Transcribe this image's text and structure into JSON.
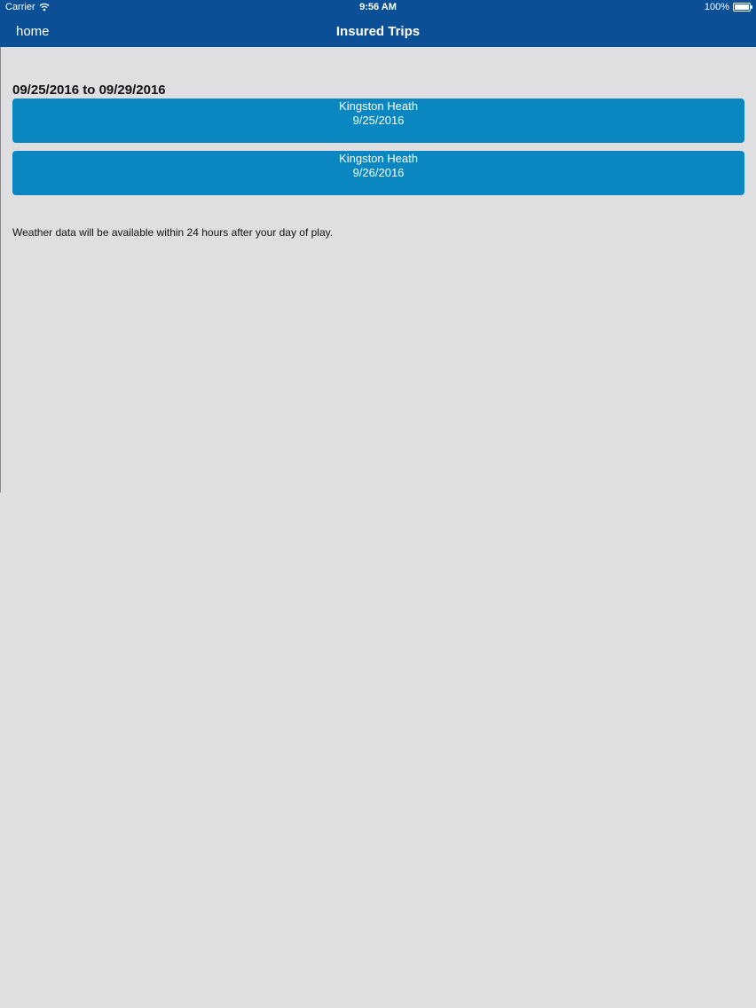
{
  "status_bar": {
    "carrier": "Carrier",
    "time": "9:56 AM",
    "battery": "100%",
    "wifi_icon": "wifi-icon",
    "battery_icon": "battery-icon"
  },
  "nav": {
    "back_label": "home",
    "title": "Insured Trips"
  },
  "colors": {
    "nav_background": "#0b4f96",
    "button_background": "#0a87c1",
    "page_background": "#dfdfe1"
  },
  "trips": {
    "date_range": "09/25/2016 to 09/29/2016",
    "items": [
      {
        "course": "Kingston Heath",
        "date": "9/25/2016"
      },
      {
        "course": "Kingston Heath",
        "date": "9/26/2016"
      }
    ]
  },
  "weather_note": "Weather data will be available within 24 hours after your day of play."
}
